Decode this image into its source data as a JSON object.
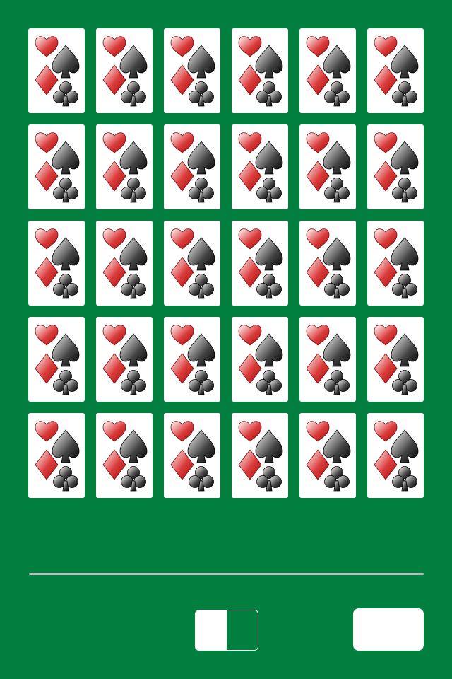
{
  "game": {
    "board_color": "#007f3f",
    "card_face": "#ffffff",
    "rows": 5,
    "columns": 6,
    "card_icon": "four-suits-card-back",
    "suit_colors": {
      "red": "#d01a1a",
      "black": "#1a1a1a"
    }
  },
  "controls": {
    "toggle_icon": "split-toggle",
    "action_button_label": ""
  }
}
